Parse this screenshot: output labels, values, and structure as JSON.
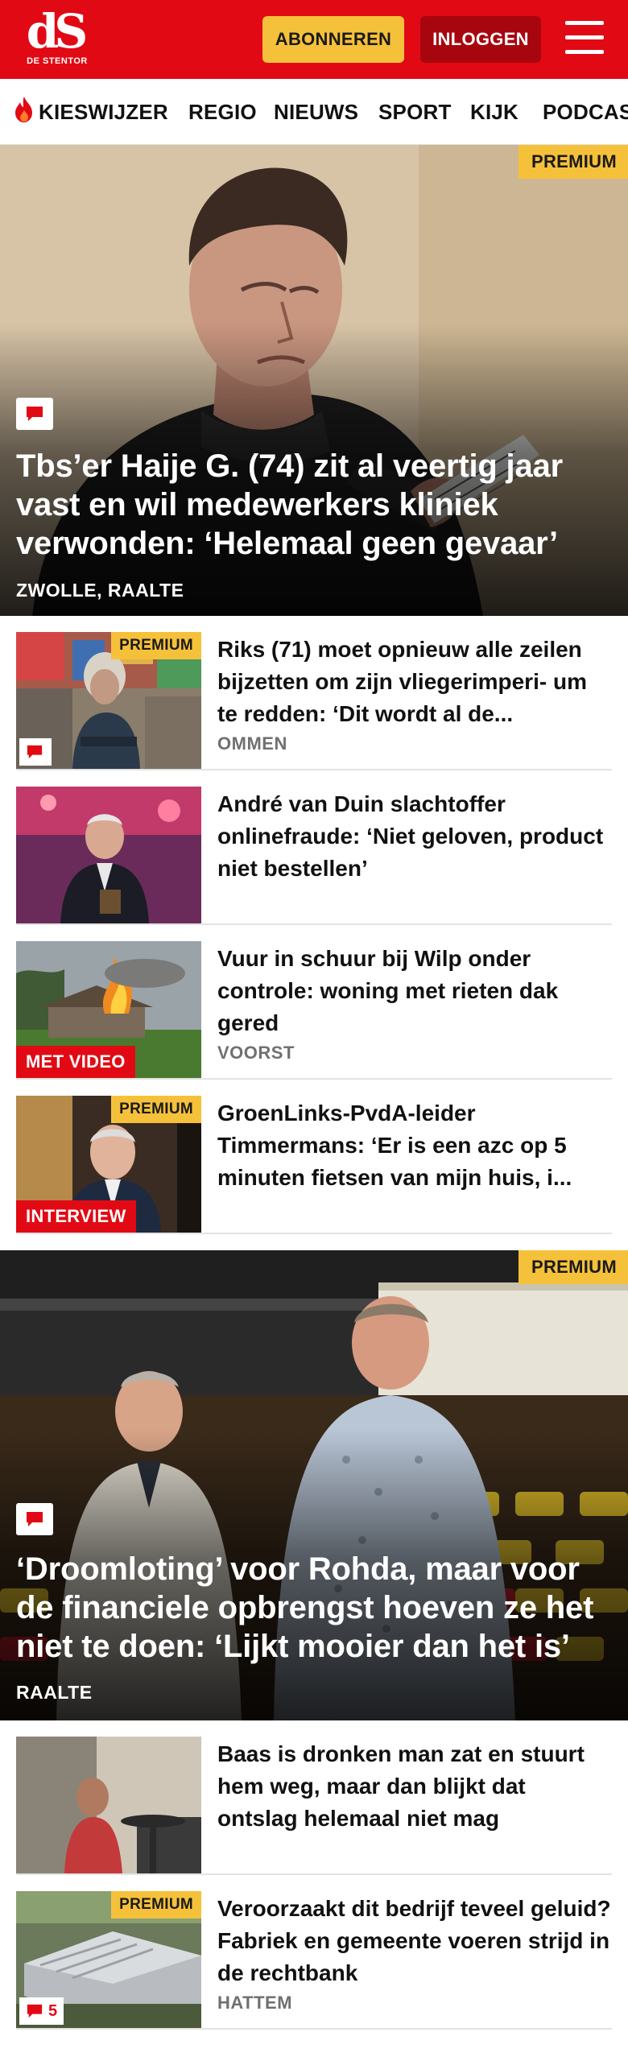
{
  "header": {
    "logo_mark": "dS",
    "logo_sub": "DE STENTOR",
    "subscribe_label": "ABONNEREN",
    "login_label": "INLOGGEN"
  },
  "nav": {
    "items": [
      "KIESWIJZER",
      "REGIO",
      "NIEUWS",
      "SPORT",
      "KIJK",
      "PODCAS"
    ]
  },
  "colors": {
    "brand_red": "#e10a14",
    "premium_yellow": "#f6c13a",
    "login_dark_red": "#a8060f"
  },
  "hero1": {
    "premium": "PREMIUM",
    "title": "Tbs’er Haije G. (74) zit al veertig jaar vast en wil medewerkers kliniek verwonden: ‘Helemaal geen gevaar’",
    "location": "ZWOLLE, RAALTE"
  },
  "items": [
    {
      "premium": "PREMIUM",
      "title": "Riks (71) moet opnieuw alle zeilen bijzetten om zijn vliegerimperi- um te redden: ‘Dit wordt al de...",
      "location": "OMMEN"
    },
    {
      "title": "André van Duin slachtoffer onlinefraude: ‘Niet geloven, product niet bestellen’"
    },
    {
      "label": "MET VIDEO",
      "title": "Vuur in schuur bij Wilp onder controle: woning met rieten dak gered",
      "location": "VOORST"
    },
    {
      "premium": "PREMIUM",
      "label": "INTERVIEW",
      "title": "GroenLinks-PvdA-leider Timmermans: ‘Er is een azc op 5 minuten fietsen van mijn huis, i..."
    }
  ],
  "hero2": {
    "premium": "PREMIUM",
    "title": "‘Droomloting’ voor Rohda, maar voor de financiele opbrengst hoeven ze het niet te doen: ‘Lijkt mooier dan het is’",
    "location": "RAALTE"
  },
  "items2": [
    {
      "title": "Baas is dronken man zat en stuurt hem weg, maar dan blijkt dat ontslag helemaal niet mag"
    },
    {
      "premium": "PREMIUM",
      "comments": "5",
      "title": "Veroorzaakt dit bedrijf teveel geluid? Fabriek en gemeente voeren strijd in de rechtbank",
      "location": "HATTEM"
    }
  ],
  "icons": {
    "flame": "flame-icon",
    "comment": "comment-icon",
    "menu": "hamburger-menu-icon"
  }
}
